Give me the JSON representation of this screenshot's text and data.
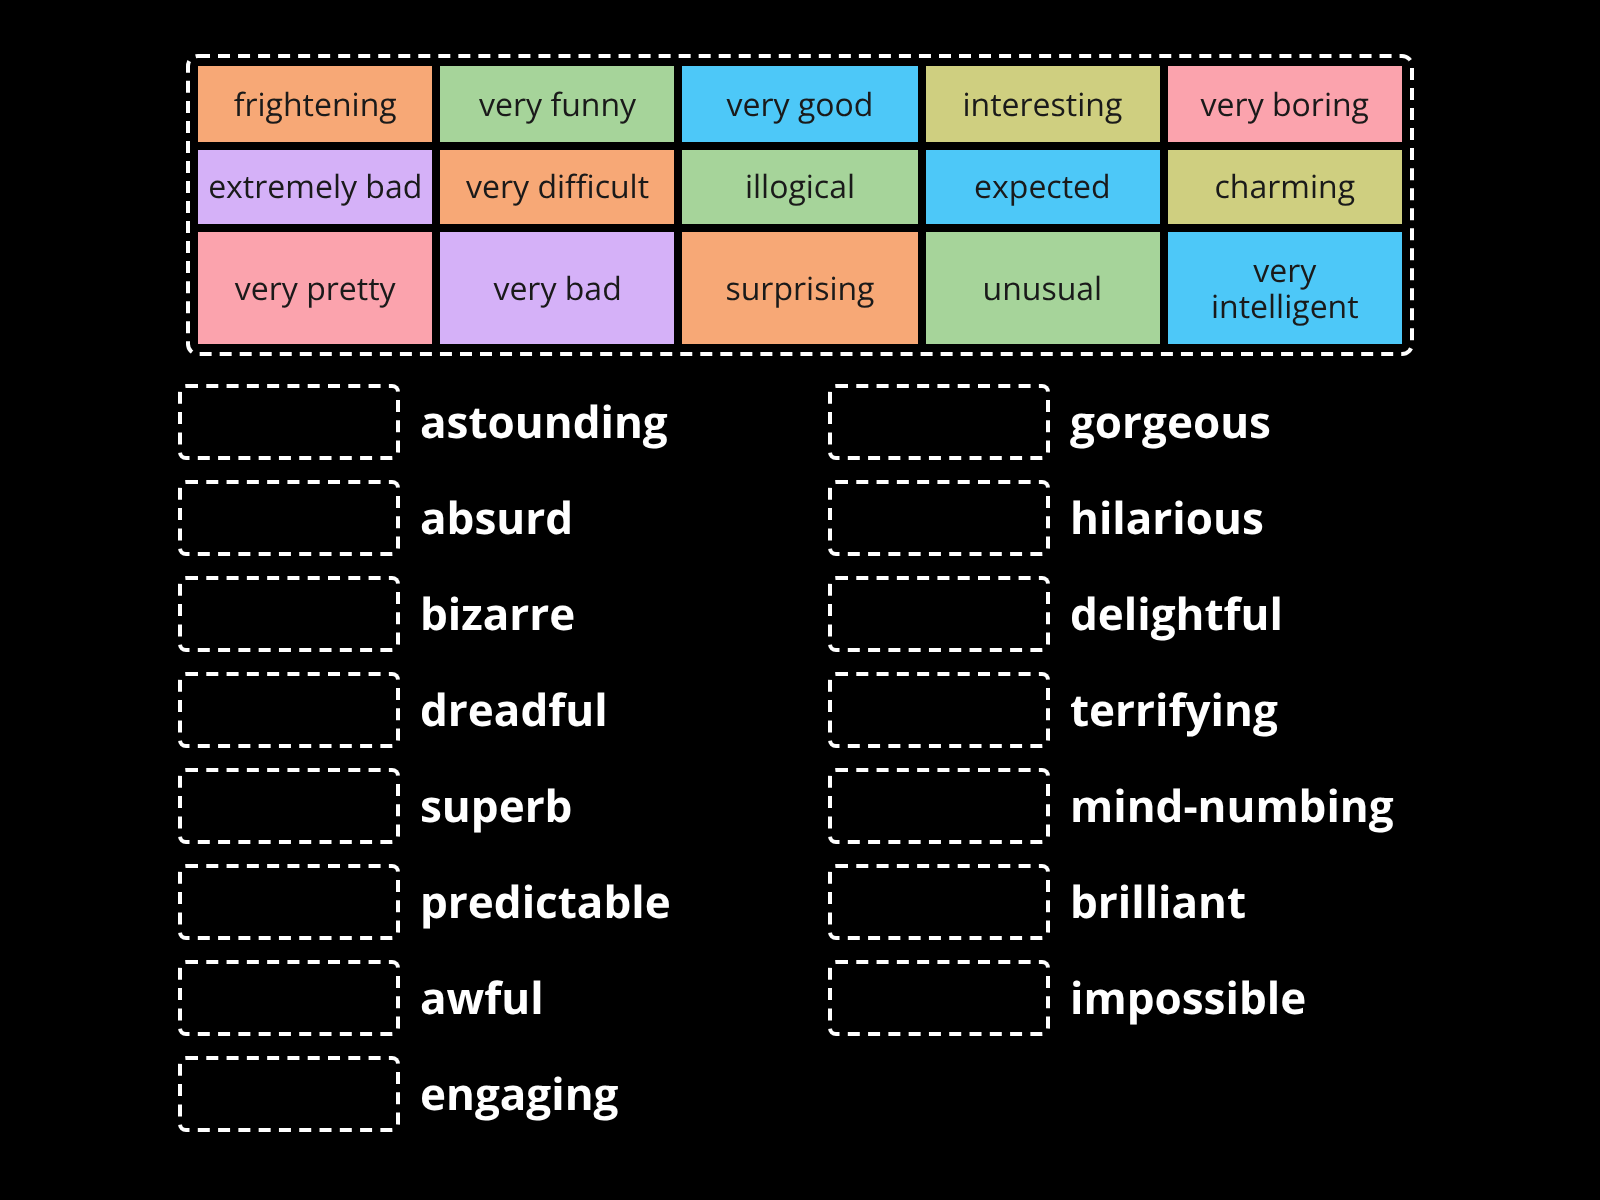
{
  "tiles": [
    {
      "label": "frightening",
      "color": "#f7a876"
    },
    {
      "label": "very funny",
      "color": "#a6d49a"
    },
    {
      "label": "very good",
      "color": "#4dc8f8"
    },
    {
      "label": "interesting",
      "color": "#cfcf80"
    },
    {
      "label": "very boring",
      "color": "#fba3ad"
    },
    {
      "label": "extremely bad",
      "color": "#d5b1f8"
    },
    {
      "label": "very difficult",
      "color": "#f7a876"
    },
    {
      "label": "illogical",
      "color": "#a6d49a"
    },
    {
      "label": "expected",
      "color": "#4dc8f8"
    },
    {
      "label": "charming",
      "color": "#cfcf80"
    },
    {
      "label": "very pretty",
      "color": "#fba3ad"
    },
    {
      "label": "very bad",
      "color": "#d5b1f8"
    },
    {
      "label": "surprising",
      "color": "#f7a876"
    },
    {
      "label": "unusual",
      "color": "#a6d49a"
    },
    {
      "label": "very intelligent",
      "color": "#4dc8f8"
    }
  ],
  "columns": [
    [
      "astounding",
      "absurd",
      "bizarre",
      "dreadful",
      "superb",
      "predictable",
      "awful",
      "engaging"
    ],
    [
      "gorgeous",
      "hilarious",
      "delightful",
      "terrifying",
      "mind-numbing",
      "brilliant",
      "impossible"
    ]
  ]
}
